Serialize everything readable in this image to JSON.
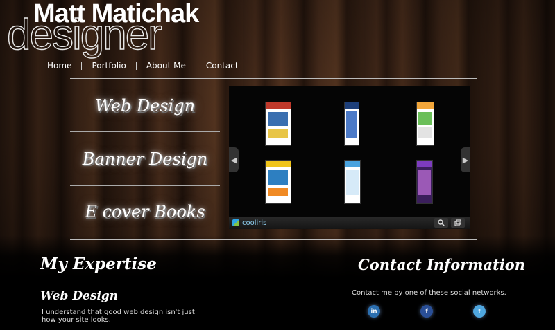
{
  "brand": {
    "name": "Matt Matichak",
    "role": "designer"
  },
  "nav": {
    "items": [
      "Home",
      "Portfolio",
      "About Me",
      "Contact"
    ]
  },
  "sidebar": {
    "items": [
      "Web Design",
      "Banner Design",
      "E cover Books"
    ]
  },
  "viewer": {
    "brand_label": "cooliris",
    "prev_icon": "chevron-left-icon",
    "next_icon": "chevron-right-icon",
    "search_icon": "search-icon",
    "fullscreen_icon": "fullscreen-icon"
  },
  "expertise": {
    "heading": "My Expertise",
    "subheading": "Web Design",
    "text_line1": "I understand that good web design isn't just",
    "text_line2": "how your site looks."
  },
  "contact": {
    "heading": "Contact Information",
    "text": "Contact me by one of these social networks.",
    "networks": [
      {
        "icon": "linkedin-icon",
        "glyph": "in",
        "color": "#2b6fb0"
      },
      {
        "icon": "facebook-icon",
        "glyph": "f",
        "color": "#2a4f97"
      },
      {
        "icon": "twitter-icon",
        "glyph": "t",
        "color": "#4fa7e0"
      }
    ]
  }
}
